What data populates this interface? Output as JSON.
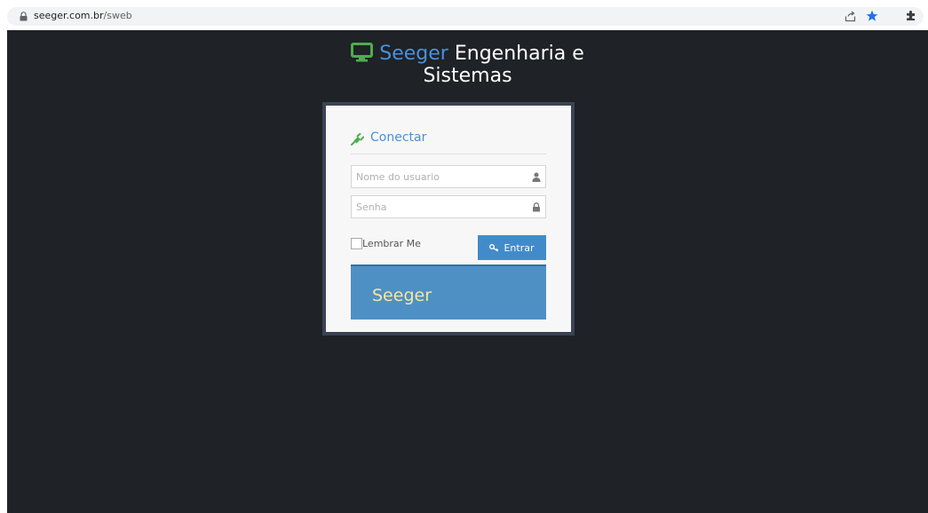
{
  "browser": {
    "url_host": "seeger.com.br",
    "url_path": "/sweb",
    "icons": [
      "lock-icon",
      "share-icon",
      "star-icon",
      "extensions-icon"
    ],
    "star_color": "#1a73e8"
  },
  "brand": {
    "name_blue": "Seeger",
    "name_rest": " Engenharia e",
    "line2": "Sistemas",
    "icon": "monitor-icon",
    "icon_color": "#4cae4c",
    "accent_color": "#4a90d9"
  },
  "login": {
    "legend": "Conectar",
    "legend_icon": "plug-icon",
    "username_placeholder": "Nome do usuario",
    "password_placeholder": "Senha",
    "username_value": "",
    "password_value": "",
    "remember_label": "Lembrar Me",
    "remember_checked": false,
    "submit_label": "Entrar",
    "submit_icon": "key-icon",
    "button_color": "#428bca",
    "banner_text": "Seeger",
    "banner_color": "#4f90c4",
    "banner_text_color": "#f5e79e"
  },
  "page": {
    "background_color": "#1f2226",
    "frame_color": "#3a4454"
  }
}
